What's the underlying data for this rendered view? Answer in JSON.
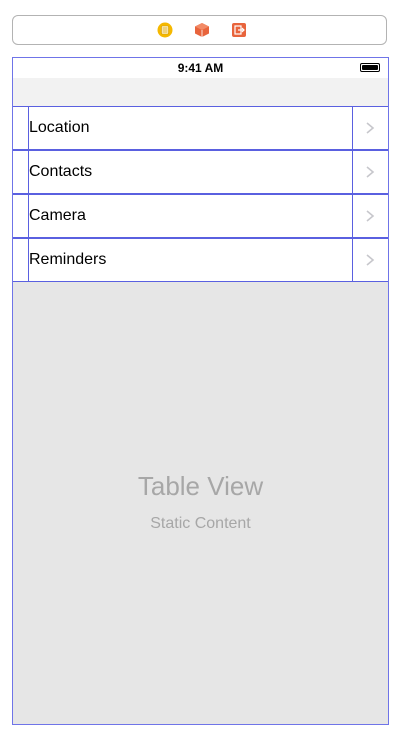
{
  "scene_dock": {
    "icons": [
      "view-controller-icon",
      "first-responder-icon",
      "exit-icon"
    ],
    "colors": {
      "view_controller": "#f5b800",
      "first_responder": "#e8643c",
      "exit": "#e8643c"
    }
  },
  "status_bar": {
    "time": "9:41 AM"
  },
  "table": {
    "rows": [
      {
        "label": "Location"
      },
      {
        "label": "Contacts"
      },
      {
        "label": "Camera"
      },
      {
        "label": "Reminders"
      }
    ]
  },
  "placeholder": {
    "title": "Table View",
    "subtitle": "Static Content"
  },
  "colors": {
    "selection_outline": "#5a60e0",
    "table_background": "#e6e6e6",
    "placeholder_text": "#a7a7a7"
  }
}
